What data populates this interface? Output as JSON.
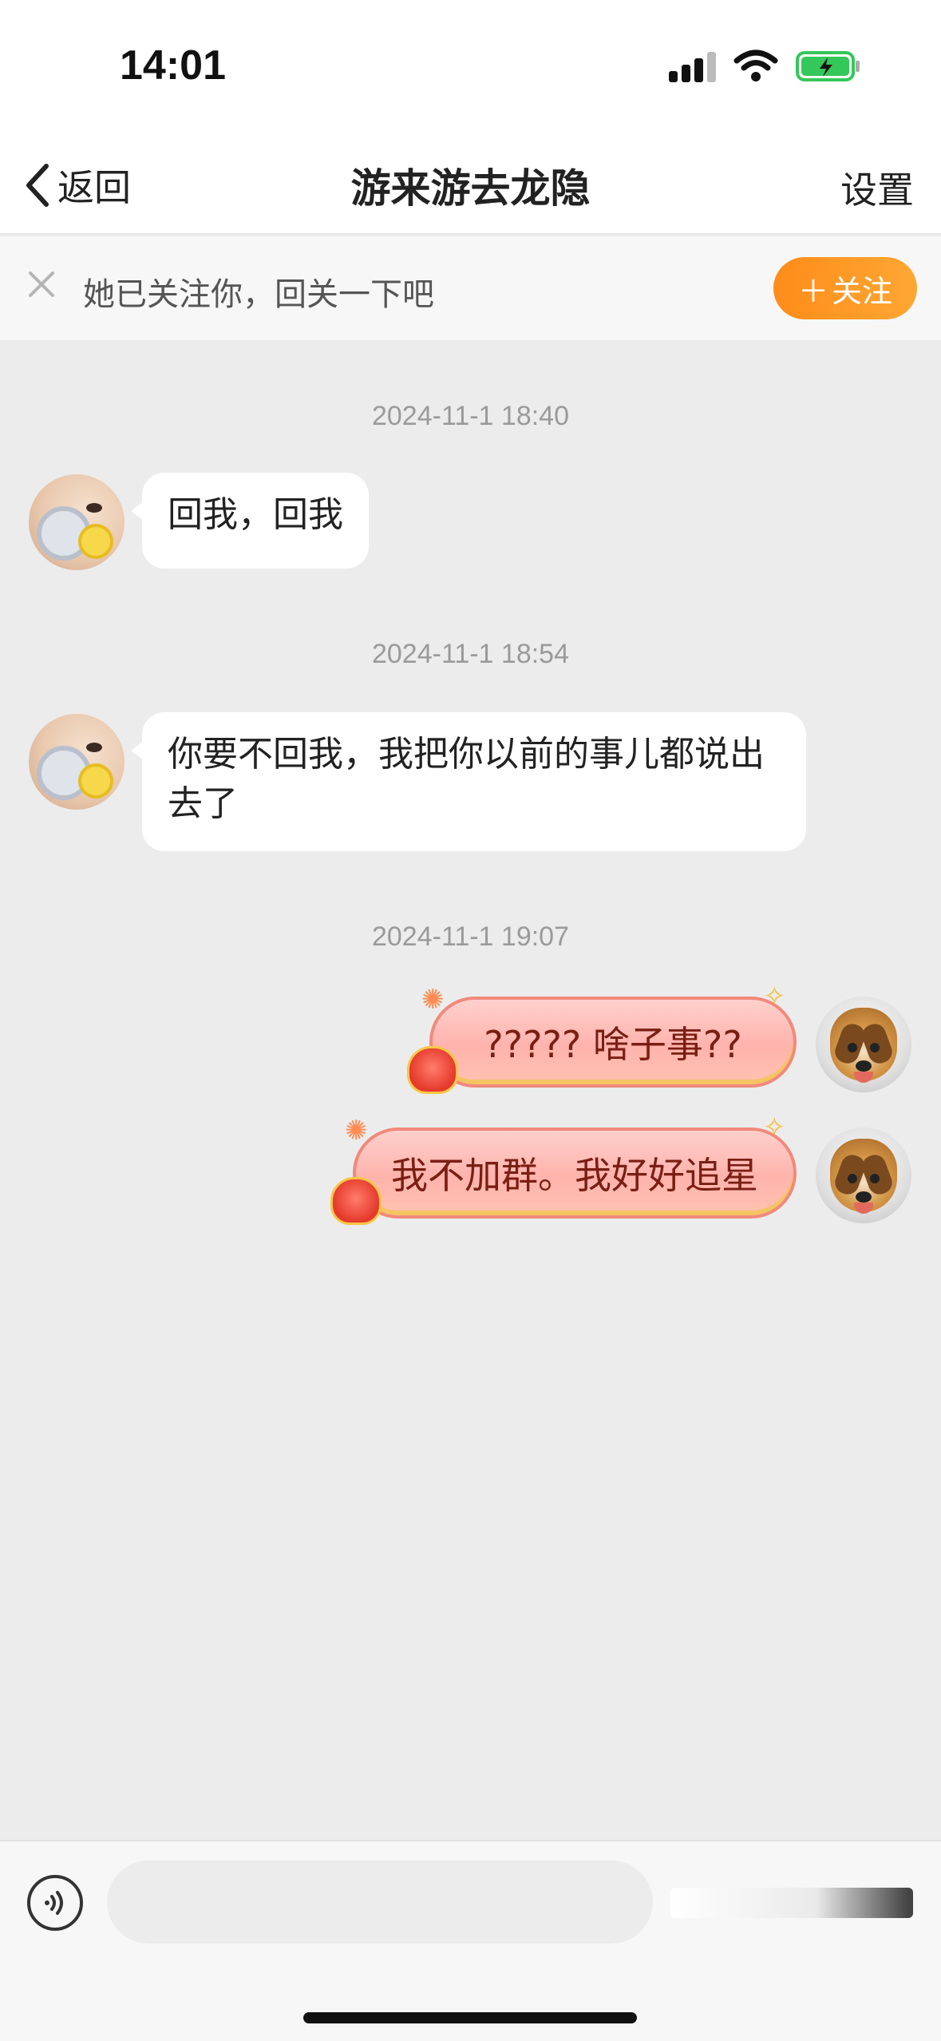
{
  "status_bar": {
    "time": "14:01",
    "icons": [
      "signal-icon",
      "wifi-icon",
      "battery-charging-icon"
    ],
    "battery_color": "#34c759"
  },
  "nav": {
    "back_label": "返回",
    "title": "游来游去龙隐",
    "settings_label": "设置"
  },
  "follow_banner": {
    "text": "她已关注你，回关一下吧",
    "button_label": "关注",
    "button_color": "#ff8c1a"
  },
  "messages": [
    {
      "timestamp": "2024-11-1 18:40",
      "side": "left",
      "text": "回我，回我"
    },
    {
      "timestamp": "2024-11-1 18:54",
      "side": "left",
      "text": "你要不回我，我把你以前的事儿都说出去了"
    },
    {
      "timestamp": "2024-11-1 19:07",
      "side": "right",
      "text": "????? 啥子事??"
    },
    {
      "timestamp": "",
      "side": "right",
      "text": "我不加群。我好好追星"
    }
  ],
  "input_bar": {
    "placeholder": ""
  }
}
